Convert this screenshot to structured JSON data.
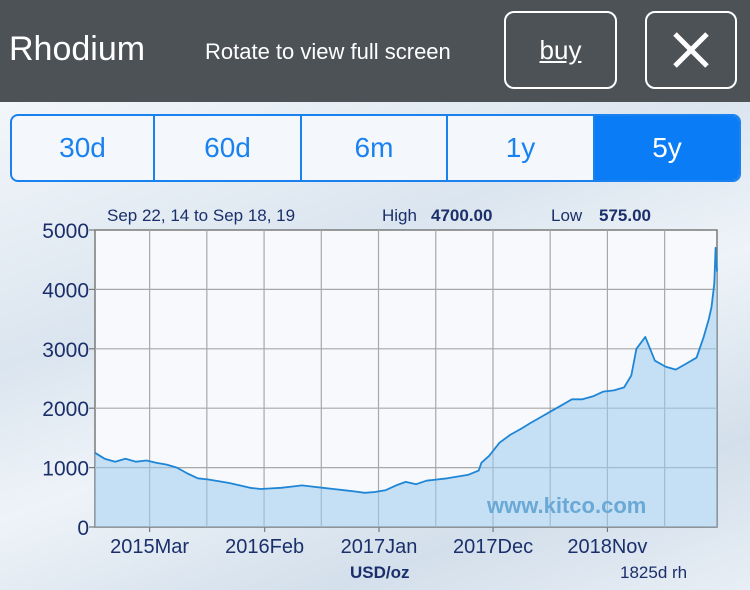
{
  "header": {
    "title": "Rhodium",
    "rotate_hint": "Rotate to view full screen",
    "buy_label": "buy"
  },
  "tabs": [
    {
      "label": "30d",
      "active": false
    },
    {
      "label": "60d",
      "active": false
    },
    {
      "label": "6m",
      "active": false
    },
    {
      "label": "1y",
      "active": false
    },
    {
      "label": "5y",
      "active": true
    }
  ],
  "chart_data": {
    "type": "area",
    "date_range": "Sep 22, 14 to Sep 18, 19",
    "high_label": "High",
    "high_value": "4700.00",
    "low_label": "Low",
    "low_value": "575.00",
    "unit": "USD/oz",
    "period_note": "1825d rh",
    "watermark": "www.kitco.com",
    "ylim": [
      0,
      5000
    ],
    "yticks": [
      0,
      1000,
      2000,
      3000,
      4000,
      5000
    ],
    "xticks": [
      "2015Mar",
      "2016Feb",
      "2017Jan",
      "2017Dec",
      "2018Nov"
    ],
    "xtick_dates": [
      "2015-03-01",
      "2016-02-01",
      "2017-01-01",
      "2017-12-01",
      "2018-11-01"
    ],
    "x_range": [
      "2014-09-22",
      "2019-09-18"
    ],
    "line_color": "#1f86d6",
    "fill_color": "#9ccbee",
    "series": [
      {
        "x": [
          "2014-09-22",
          "2014-10-20",
          "2014-11-20",
          "2014-12-20",
          "2015-01-20",
          "2015-02-20",
          "2015-03-20",
          "2015-04-20",
          "2015-05-20",
          "2015-06-20",
          "2015-07-20",
          "2015-08-20",
          "2015-09-20",
          "2015-10-20",
          "2015-11-20",
          "2015-12-20",
          "2016-01-20",
          "2016-02-20",
          "2016-03-20",
          "2016-04-20",
          "2016-05-20",
          "2016-06-20",
          "2016-07-20",
          "2016-08-20",
          "2016-09-20",
          "2016-10-20",
          "2016-11-20",
          "2016-12-20",
          "2017-01-20",
          "2017-02-20",
          "2017-03-20",
          "2017-04-20",
          "2017-05-20",
          "2017-06-20",
          "2017-07-20",
          "2017-08-20",
          "2017-09-20",
          "2017-10-20",
          "2017-10-28",
          "2017-11-20",
          "2017-12-20",
          "2018-01-20",
          "2018-02-20",
          "2018-03-20",
          "2018-04-20",
          "2018-05-20",
          "2018-06-20",
          "2018-07-20",
          "2018-08-20",
          "2018-09-20",
          "2018-10-20",
          "2018-11-20",
          "2018-12-20",
          "2019-01-10",
          "2019-01-25",
          "2019-02-20",
          "2019-03-20",
          "2019-04-20",
          "2019-05-20",
          "2019-06-20",
          "2019-07-20",
          "2019-08-10",
          "2019-08-25",
          "2019-09-02",
          "2019-09-10",
          "2019-09-14",
          "2019-09-18"
        ],
        "values": [
          1250,
          1150,
          1100,
          1150,
          1100,
          1120,
          1080,
          1050,
          1000,
          900,
          820,
          800,
          770,
          740,
          700,
          660,
          640,
          650,
          660,
          680,
          700,
          680,
          660,
          640,
          620,
          600,
          575,
          590,
          620,
          700,
          760,
          720,
          780,
          800,
          820,
          850,
          880,
          950,
          1080,
          1200,
          1420,
          1550,
          1650,
          1750,
          1850,
          1950,
          2050,
          2150,
          2150,
          2200,
          2280,
          2300,
          2350,
          2550,
          3000,
          3200,
          2800,
          2700,
          2650,
          2750,
          2850,
          3200,
          3500,
          3700,
          4100,
          4700,
          4300
        ]
      }
    ]
  }
}
